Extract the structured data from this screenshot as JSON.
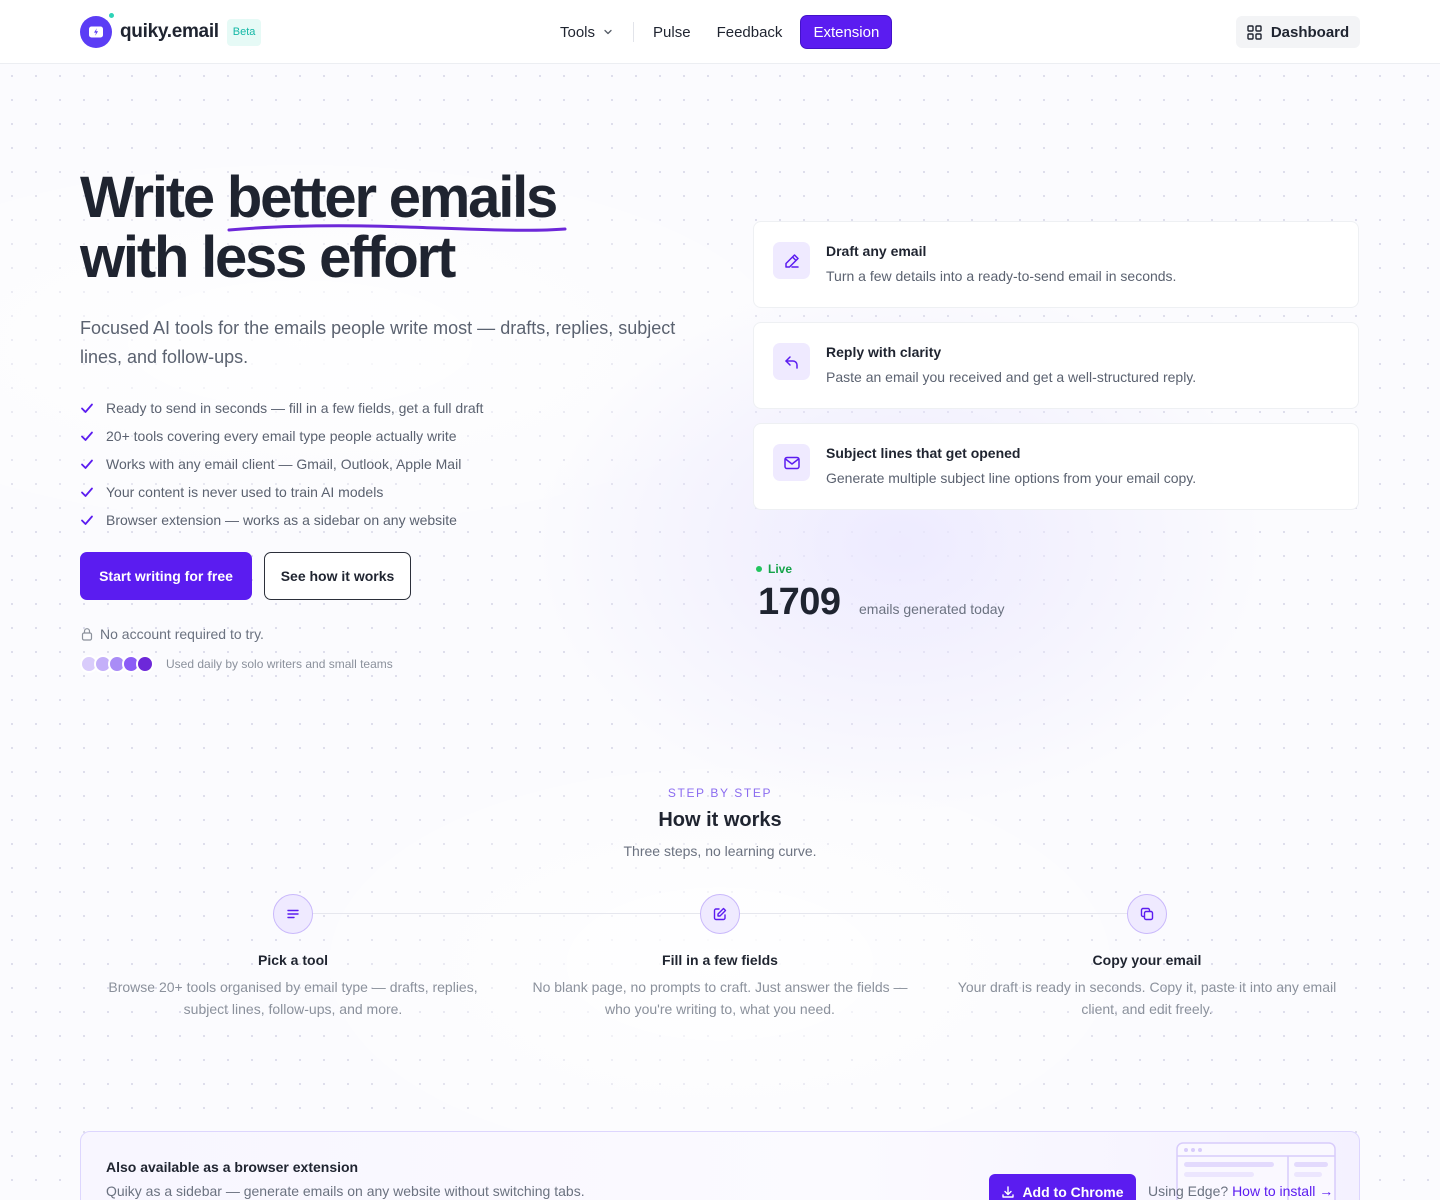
{
  "brand": {
    "name": "quiky.email",
    "badge": "Beta",
    "accent": "#5b1cf0",
    "teal": "#2ed3b7"
  },
  "nav": {
    "tools": "Tools",
    "pulse": "Pulse",
    "feedback": "Feedback",
    "extension": "Extension",
    "dashboard": "Dashboard"
  },
  "hero": {
    "title_part1": "Write ",
    "title_highlight": "better emails",
    "title_part2": "with less effort",
    "subtitle": "Focused AI tools for the emails people write most — drafts, replies, subject lines, and follow-ups.",
    "checks": [
      "Ready to send in seconds — fill in a few fields, get a full draft",
      "20+ tools covering every email type people actually write",
      "Works with any email client — Gmail, Outlook, Apple Mail",
      "Your content is never used to train AI models",
      "Browser extension — works as a sidebar on any website"
    ],
    "primary_cta": "Start writing for free",
    "secondary_cta": "See how it works",
    "no_account": "No account required to try.",
    "social_proof": "Used daily by solo writers and small teams",
    "avatar_colors": [
      "#d9ccfb",
      "#c4b0f9",
      "#a98cf6",
      "#8b5cf6",
      "#6d28d9"
    ]
  },
  "features": [
    {
      "icon": "pencil-icon",
      "title": "Draft any email",
      "desc": "Turn a few details into a ready-to-send email in seconds."
    },
    {
      "icon": "reply-icon",
      "title": "Reply with clarity",
      "desc": "Paste an email you received and get a well-structured reply."
    },
    {
      "icon": "envelope-icon",
      "title": "Subject lines that get opened",
      "desc": "Generate multiple subject line options from your email copy."
    }
  ],
  "live": {
    "label": "Live",
    "count": "1709",
    "caption": "emails generated today"
  },
  "how": {
    "eyebrow": "STEP BY STEP",
    "title": "How it works",
    "subtitle": "Three steps, no learning curve.",
    "steps": [
      {
        "icon": "list-icon",
        "title": "Pick a tool",
        "desc": "Browse 20+ tools organised by email type — drafts, replies, subject lines, follow-ups, and more."
      },
      {
        "icon": "edit-icon",
        "title": "Fill in a few fields",
        "desc": "No blank page, no prompts to craft. Just answer the fields — who you're writing to, what you need."
      },
      {
        "icon": "copy-icon",
        "title": "Copy your email",
        "desc": "Your draft is ready in seconds. Copy it, paste it into any email client, and edit freely."
      }
    ]
  },
  "extension_banner": {
    "title": "Also available as a browser extension",
    "desc": "Quiky as a sidebar — generate emails on any website without switching tabs.",
    "cta": "Add to Chrome",
    "edge_prefix": "Using Edge? ",
    "edge_link": "How to install →"
  }
}
